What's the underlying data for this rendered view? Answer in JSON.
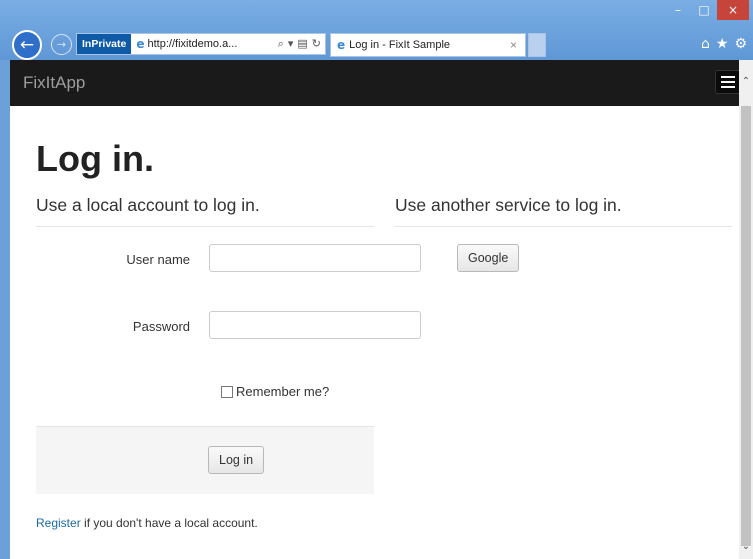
{
  "browser": {
    "inprivate_label": "InPrivate",
    "url": "http://fixitdemo.a...",
    "tab_title": "Log in - FixIt Sample",
    "tab_close": "×",
    "back_glyph": "←",
    "forward_glyph": "→",
    "window_controls": {
      "minimize": "–",
      "maximize": "□",
      "close": "×"
    },
    "icons": [
      "search-icon",
      "dropdown-icon",
      "compat-view-icon",
      "refresh-icon",
      "home-icon",
      "favorites-icon",
      "settings-icon"
    ]
  },
  "navbar": {
    "brand": "FixItApp"
  },
  "page": {
    "title": "Log in.",
    "local_heading": "Use a local account to log in.",
    "other_heading": "Use another service to log in.",
    "username_label": "User name",
    "username_value": "",
    "password_label": "Password",
    "password_value": "",
    "remember_label": "Remember me?",
    "login_button": "Log in",
    "google_button": "Google",
    "register_link": "Register",
    "register_suffix": " if you don't have a local account."
  }
}
